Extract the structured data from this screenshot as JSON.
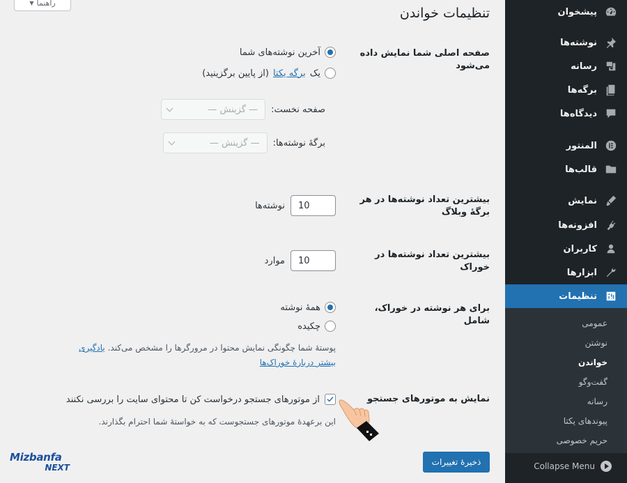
{
  "help_tab": {
    "label": "راهنما"
  },
  "page": {
    "title": "تنظیمات خواندن"
  },
  "homepage": {
    "label": "صفحه اصلی شما نمایش داده می‌شود",
    "option_latest": "آخرین نوشته‌های شما",
    "option_static_prefix": "یک",
    "option_static_link": "برگه یکتا",
    "option_static_suffix": "(از پایین برگزینید)",
    "front_page_label": "صفحه نخست:",
    "front_page_value": "— گزینش —",
    "posts_page_label": "برگهٔ نوشته‌ها:",
    "posts_page_value": "— گزینش —"
  },
  "posts_per_page": {
    "label": "بیشترین تعداد نوشته‌ها در هر برگهٔ وبلاگ",
    "value": "10",
    "unit": "نوشته‌ها"
  },
  "posts_per_rss": {
    "label": "بیشترین تعداد نوشته‌ها در خوراک",
    "value": "10",
    "unit": "موارد"
  },
  "rss_content": {
    "label": "برای هر نوشته در خوراک، شامل",
    "option_full": "همهٔ نوشته",
    "option_excerpt": "چکیده",
    "desc": "پوستهٔ شما چگونگی نمایش محتوا در مرورگرها را مشخص می‌کند.",
    "desc_link_1": "یادگیری",
    "desc_link_2": "بیشتر دربارهٔ خوراک‌ها"
  },
  "search_visibility": {
    "label": "نمایش به موتورهای جستجو",
    "checkbox_label": "از موتورهای جستجو درخواست کن تا محتوای سایت را بررسی نکنند",
    "desc": "این برعهدهٔ موتورهای جستجوست که به خواستهٔ شما احترام بگذارند."
  },
  "save_button": {
    "label": "ذخیرهٔ تغییرات"
  },
  "sidebar": {
    "items": [
      {
        "label": "پیشخوان",
        "icon": "dashboard-icon"
      },
      {
        "label": "نوشته‌ها",
        "icon": "pin-icon"
      },
      {
        "label": "رسانه",
        "icon": "media-icon"
      },
      {
        "label": "برگه‌ها",
        "icon": "pages-icon"
      },
      {
        "label": "دیدگاه‌ها",
        "icon": "comments-icon"
      },
      {
        "label": "المنتور",
        "icon": "elementor-icon"
      },
      {
        "label": "قالب‌ها",
        "icon": "folder-icon"
      },
      {
        "label": "نمایش",
        "icon": "appearance-icon"
      },
      {
        "label": "افزونه‌ها",
        "icon": "plugins-icon"
      },
      {
        "label": "کاربران",
        "icon": "users-icon"
      },
      {
        "label": "ابزارها",
        "icon": "tools-icon"
      },
      {
        "label": "تنظیمات",
        "icon": "settings-icon"
      }
    ],
    "submenu": [
      "عمومی",
      "نوشتن",
      "خواندن",
      "گفت‌وگو",
      "رسانه",
      "پیوندهای یکتا",
      "حریم خصوصی"
    ],
    "collapse_label": "Collapse Menu"
  },
  "logo": {
    "line1": "Mizbanfa",
    "line2": "NEXT"
  },
  "colors": {
    "accent": "#2271b1",
    "sidebar_bg": "#1d2327",
    "submenu_bg": "#2c3338",
    "page_bg": "#f0f0f1"
  }
}
